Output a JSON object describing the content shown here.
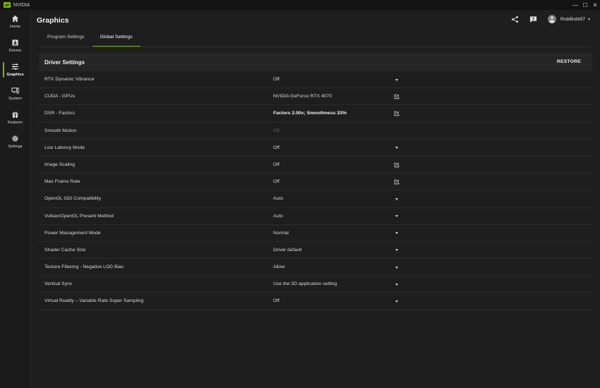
{
  "app": {
    "title": "NVIDIA",
    "brand_color": "#76b900"
  },
  "window": {
    "minimize": "—",
    "maximize": "☐",
    "close": "✕"
  },
  "sidebar": {
    "items": [
      {
        "label": "Home",
        "icon": "home-icon",
        "active": false
      },
      {
        "label": "Drivers",
        "icon": "download-box-icon",
        "active": false
      },
      {
        "label": "Graphics",
        "icon": "sliders-icon",
        "active": true
      },
      {
        "label": "System",
        "icon": "monitor-icon",
        "active": false
      },
      {
        "label": "Redeem",
        "icon": "gift-icon",
        "active": false
      },
      {
        "label": "Settings",
        "icon": "gear-icon",
        "active": false
      }
    ]
  },
  "header": {
    "title": "Graphics",
    "user": {
      "name": "RobiBobi97"
    }
  },
  "tabs": [
    {
      "label": "Program Settings",
      "active": false
    },
    {
      "label": "Global Settings",
      "active": true
    }
  ],
  "panel": {
    "title": "Driver Settings",
    "restore_label": "RESTORE",
    "rows": [
      {
        "name": "RTX Dynamic Vibrance",
        "value": "Off",
        "control": "dropdown"
      },
      {
        "name": "CUDA - GPUs",
        "value": "NVIDIA GeForce RTX 4070",
        "control": "edit"
      },
      {
        "name": "DSR - Factors",
        "value": "Factors 2.00x; Smoothness 33%",
        "control": "edit",
        "bold": true
      },
      {
        "name": "Smooth Motion",
        "value": "Off",
        "control": "none",
        "disabled": true
      },
      {
        "name": "Low Latency Mode",
        "value": "Off",
        "control": "dropdown"
      },
      {
        "name": "Image Scaling",
        "value": "Off",
        "control": "edit"
      },
      {
        "name": "Max Frame Rate",
        "value": "Off",
        "control": "edit"
      },
      {
        "name": "OpenGL GDI Compatibility",
        "value": "Auto",
        "control": "dropdown"
      },
      {
        "name": "Vulkan/OpenGL Present Method",
        "value": "Auto",
        "control": "dropdown"
      },
      {
        "name": "Power Management Mode",
        "value": "Normal",
        "control": "dropdown"
      },
      {
        "name": "Shader Cache Size",
        "value": "Driver default",
        "control": "dropdown"
      },
      {
        "name": "Texture Filtering - Negative LOD Bias",
        "value": "Allow",
        "control": "dropdown"
      },
      {
        "name": "Vertical Sync",
        "value": "Use the 3D application setting",
        "control": "dropdown"
      },
      {
        "name": "Virtual Reality – Variable Rate Super Sampling",
        "value": "Off",
        "control": "dropdown"
      }
    ]
  }
}
